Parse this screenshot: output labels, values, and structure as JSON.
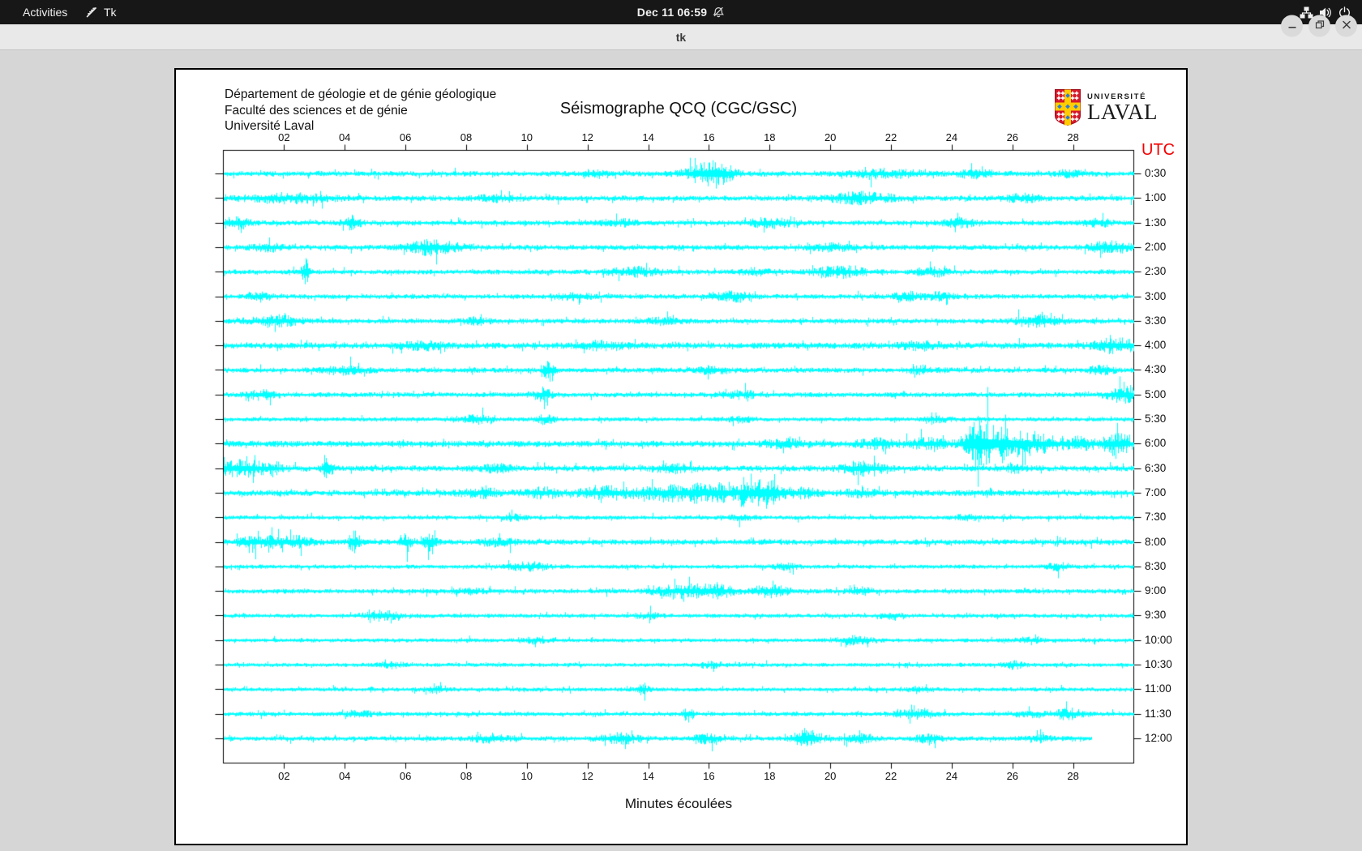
{
  "top_bar": {
    "activities_label": "Activities",
    "app_name": "Tk",
    "clock": "Dec 11  06:59",
    "icons": {
      "tk": "tk-feather-icon",
      "notifications": "bell-muted-icon",
      "network": "wired-network-icon",
      "volume": "speaker-icon",
      "power": "power-icon"
    }
  },
  "window": {
    "title": "tk",
    "controls": {
      "minimize": "minimize-icon",
      "restore": "restore-icon",
      "close": "close-icon"
    }
  },
  "figure": {
    "institution_lines": [
      "Département de géologie et de génie géologique",
      "Faculté des sciences et de génie",
      "Université Laval"
    ],
    "title": "Séismographe QCQ (CGC/GSC)",
    "logo": {
      "line1": "UNIVERSITÉ",
      "line2": "LAVAL"
    },
    "utc_label": "UTC",
    "xlabel": "Minutes écoulées",
    "colors": {
      "trace": "#00ffff",
      "utc_label": "#f40000",
      "axis": "#000000",
      "logo_red": "#d7182a",
      "logo_yellow": "#ffcd00",
      "logo_blue": "#2d7dd2"
    }
  },
  "chart_data": {
    "type": "line",
    "subtype": "helicorder-seismogram",
    "title": "Séismographe QCQ (CGC/GSC)",
    "xlabel": "Minutes écoulées",
    "right_axis_title": "UTC",
    "x_range_minutes": [
      0,
      30
    ],
    "x_tick_minutes": [
      2,
      4,
      6,
      8,
      10,
      12,
      14,
      16,
      18,
      20,
      22,
      24,
      26,
      28
    ],
    "x_tick_labels": [
      "02",
      "04",
      "06",
      "08",
      "10",
      "12",
      "14",
      "16",
      "18",
      "20",
      "22",
      "24",
      "26",
      "28"
    ],
    "row_minutes_span": 30,
    "trace_color": "#00ffff",
    "rows": [
      {
        "label": "0:30",
        "base_amp": 2.6,
        "events": [
          [
            12.2,
            3,
            0.3
          ],
          [
            15.9,
            9,
            0.5
          ],
          [
            16.4,
            6,
            0.3
          ],
          [
            21.8,
            3.5,
            0.8
          ],
          [
            24.8,
            3.5,
            0.4
          ],
          [
            27.9,
            3,
            0.3
          ]
        ]
      },
      {
        "label": "1:00",
        "base_amp": 2.6,
        "events": [
          [
            2.2,
            4,
            1.0
          ],
          [
            9.0,
            2.5,
            0.5
          ],
          [
            21.0,
            5,
            0.7
          ],
          [
            26.3,
            3,
            0.4
          ]
        ]
      },
      {
        "label": "1:30",
        "base_amp": 2.4,
        "events": [
          [
            0.4,
            5,
            0.3
          ],
          [
            4.2,
            6,
            0.2
          ],
          [
            13.0,
            3,
            0.4
          ],
          [
            18.0,
            4,
            0.5
          ],
          [
            24.2,
            4.5,
            0.35
          ],
          [
            28.8,
            3.5,
            0.3
          ]
        ]
      },
      {
        "label": "2:00",
        "base_amp": 2.4,
        "events": [
          [
            1.5,
            3,
            0.4
          ],
          [
            6.9,
            7,
            0.6
          ],
          [
            20.0,
            3,
            0.5
          ],
          [
            29.2,
            5,
            0.5
          ]
        ]
      },
      {
        "label": "2:30",
        "base_amp": 2.3,
        "events": [
          [
            2.7,
            13,
            0.1
          ],
          [
            13.5,
            4,
            0.6
          ],
          [
            17.5,
            3,
            0.4
          ],
          [
            20.3,
            5,
            0.6
          ],
          [
            23.3,
            3.5,
            0.4
          ]
        ]
      },
      {
        "label": "3:00",
        "base_amp": 2.3,
        "events": [
          [
            1.2,
            3,
            0.3
          ],
          [
            11.5,
            3,
            0.4
          ],
          [
            16.8,
            4.5,
            0.4
          ],
          [
            22.5,
            4,
            0.3
          ],
          [
            23.6,
            3.5,
            0.3
          ]
        ]
      },
      {
        "label": "3:30",
        "base_amp": 2.3,
        "events": [
          [
            1.7,
            5,
            0.6
          ],
          [
            8.3,
            3,
            0.3
          ],
          [
            14.5,
            3,
            0.4
          ],
          [
            26.8,
            5,
            0.5
          ]
        ]
      },
      {
        "label": "4:00",
        "base_amp": 3.0,
        "events": [
          [
            6.5,
            3,
            0.5
          ],
          [
            12.5,
            3.5,
            0.5
          ],
          [
            23.0,
            3,
            0.5
          ],
          [
            29.4,
            7,
            0.5
          ]
        ]
      },
      {
        "label": "4:30",
        "base_amp": 2.4,
        "events": [
          [
            4.0,
            4,
            0.5
          ],
          [
            10.7,
            11,
            0.12
          ],
          [
            16.0,
            3,
            0.4
          ],
          [
            23.0,
            3.5,
            0.3
          ],
          [
            28.9,
            4,
            0.3
          ]
        ]
      },
      {
        "label": "5:00",
        "base_amp": 2.4,
        "events": [
          [
            1.3,
            5,
            0.3
          ],
          [
            10.5,
            6,
            0.2
          ],
          [
            17.0,
            3,
            0.4
          ],
          [
            29.6,
            8,
            0.35
          ]
        ]
      },
      {
        "label": "5:30",
        "base_amp": 1.9,
        "events": [
          [
            8.3,
            4,
            0.3
          ],
          [
            10.6,
            4.5,
            0.2
          ],
          [
            17.0,
            2.5,
            0.3
          ],
          [
            23.5,
            2.5,
            0.3
          ]
        ]
      },
      {
        "label": "6:00",
        "base_amp": 3.1,
        "events": [
          [
            18.5,
            3,
            0.5
          ],
          [
            21.5,
            4,
            0.5
          ],
          [
            23.2,
            4.5,
            0.4
          ],
          [
            24.9,
            24,
            0.35
          ],
          [
            25.7,
            12,
            0.3
          ],
          [
            26.4,
            9,
            0.35
          ],
          [
            27.2,
            7,
            0.3
          ],
          [
            28.2,
            6,
            0.3
          ],
          [
            29.4,
            10,
            0.35
          ]
        ]
      },
      {
        "label": "6:30",
        "base_amp": 2.8,
        "events": [
          [
            0.6,
            7,
            0.7
          ],
          [
            3.4,
            15,
            0.1
          ],
          [
            9.0,
            3,
            0.4
          ],
          [
            14.8,
            3.5,
            0.4
          ],
          [
            21.1,
            7,
            0.45
          ],
          [
            26.0,
            3,
            0.3
          ]
        ]
      },
      {
        "label": "7:00",
        "base_amp": 2.9,
        "events": [
          [
            8.5,
            3.5,
            0.5
          ],
          [
            10.5,
            4,
            0.4
          ],
          [
            12.7,
            5,
            0.7
          ],
          [
            14.5,
            6,
            0.5
          ],
          [
            15.6,
            7,
            0.5
          ],
          [
            16.4,
            6,
            0.4
          ],
          [
            17.1,
            10,
            0.08
          ],
          [
            17.8,
            14,
            0.4
          ],
          [
            19.0,
            4,
            0.4
          ],
          [
            21.0,
            3,
            0.4
          ]
        ]
      },
      {
        "label": "7:30",
        "base_amp": 1.9,
        "events": [
          [
            9.5,
            2.5,
            0.3
          ],
          [
            17.0,
            2.5,
            0.3
          ],
          [
            24.5,
            2.5,
            0.3
          ]
        ]
      },
      {
        "label": "8:00",
        "base_amp": 2.7,
        "events": [
          [
            1.3,
            5,
            0.7
          ],
          [
            2.5,
            4,
            0.3
          ],
          [
            4.3,
            11,
            0.12
          ],
          [
            6.0,
            9,
            0.15
          ],
          [
            6.8,
            8,
            0.15
          ],
          [
            9.0,
            3,
            0.4
          ]
        ]
      },
      {
        "label": "8:30",
        "base_amp": 1.9,
        "events": [
          [
            10.0,
            4,
            0.5
          ],
          [
            18.5,
            2.5,
            0.3
          ],
          [
            27.5,
            3,
            0.3
          ]
        ]
      },
      {
        "label": "9:00",
        "base_amp": 2.2,
        "events": [
          [
            8.0,
            2.5,
            0.4
          ],
          [
            15.2,
            6,
            0.7
          ],
          [
            16.3,
            4.5,
            0.4
          ],
          [
            18.0,
            6,
            0.4
          ],
          [
            21.0,
            3,
            0.3
          ]
        ]
      },
      {
        "label": "9:30",
        "base_amp": 1.9,
        "events": [
          [
            5.2,
            4.5,
            0.4
          ],
          [
            14.0,
            2.5,
            0.3
          ],
          [
            22.0,
            2.5,
            0.3
          ]
        ]
      },
      {
        "label": "10:00",
        "base_amp": 1.8,
        "events": [
          [
            10.2,
            2.5,
            0.3
          ],
          [
            20.8,
            4,
            0.4
          ],
          [
            26.5,
            2.5,
            0.3
          ]
        ]
      },
      {
        "label": "10:30",
        "base_amp": 1.8,
        "events": [
          [
            5.5,
            2.5,
            0.3
          ],
          [
            16.0,
            2.5,
            0.3
          ],
          [
            26.0,
            3.5,
            0.25
          ]
        ]
      },
      {
        "label": "11:00",
        "base_amp": 1.8,
        "events": [
          [
            7.0,
            2.5,
            0.3
          ],
          [
            13.8,
            5,
            0.15
          ],
          [
            23.0,
            2.5,
            0.3
          ]
        ]
      },
      {
        "label": "11:30",
        "base_amp": 2.0,
        "events": [
          [
            4.5,
            2.5,
            0.3
          ],
          [
            15.3,
            7,
            0.12
          ],
          [
            22.8,
            4,
            0.5
          ],
          [
            26.5,
            3,
            0.3
          ],
          [
            27.8,
            5,
            0.35
          ]
        ]
      },
      {
        "label": "12:00",
        "base_amp": 2.2,
        "end_min": 28.6,
        "events": [
          [
            8.8,
            4,
            0.4
          ],
          [
            13.0,
            4.5,
            0.5
          ],
          [
            15.9,
            5,
            0.3
          ],
          [
            19.2,
            9,
            0.3
          ],
          [
            21.0,
            4.5,
            0.3
          ],
          [
            23.2,
            3.5,
            0.3
          ],
          [
            26.8,
            3,
            0.3
          ]
        ]
      }
    ]
  }
}
